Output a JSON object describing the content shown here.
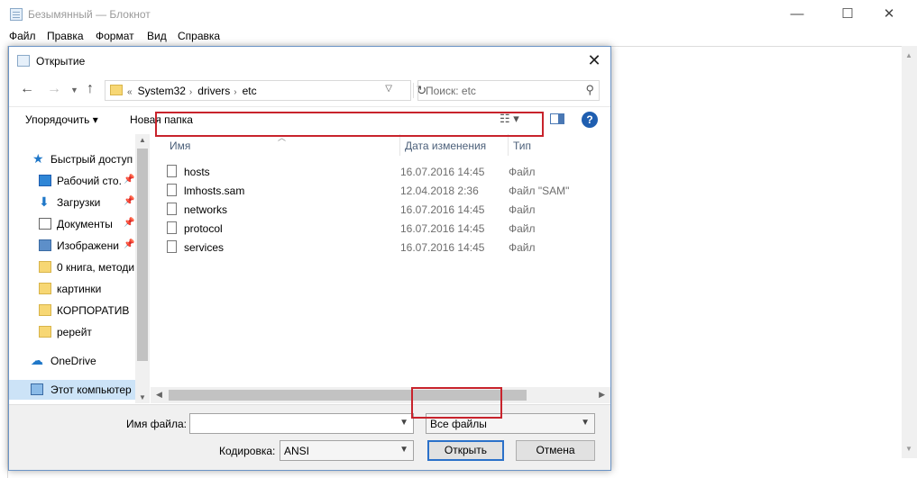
{
  "notepad": {
    "title": "Безымянный — Блокнот",
    "menu": [
      "Файл",
      "Правка",
      "Формат",
      "Вид",
      "Справка"
    ],
    "minimize": "—",
    "maximize": "☐",
    "close": "✕"
  },
  "dialog": {
    "title": "Открытие",
    "close": "✕",
    "address": {
      "prefix": "«",
      "crumbs": [
        "System32",
        "drivers",
        "etc"
      ]
    },
    "search_placeholder": "Поиск: etc",
    "toolbar": {
      "organize": "Упорядочить ▾",
      "new_folder": "Новая папка",
      "help": "?"
    },
    "nav": [
      {
        "label": "Быстрый доступ",
        "icon": "star-icon",
        "pinned": false
      },
      {
        "label": "Рабочий сто.",
        "icon": "desktop-icon",
        "pinned": true
      },
      {
        "label": "Загрузки",
        "icon": "download-icon",
        "pinned": true
      },
      {
        "label": "Документы",
        "icon": "documents-icon",
        "pinned": true
      },
      {
        "label": "Изображени",
        "icon": "pictures-icon",
        "pinned": true
      },
      {
        "label": "0 книга, методи",
        "icon": "folder-icon",
        "pinned": false
      },
      {
        "label": "картинки",
        "icon": "folder-icon",
        "pinned": false
      },
      {
        "label": "КОРПОРАТИВ",
        "icon": "folder-icon",
        "pinned": false
      },
      {
        "label": "ререйт",
        "icon": "folder-icon",
        "pinned": false
      },
      {
        "label": "OneDrive",
        "icon": "cloud-icon",
        "pinned": false
      },
      {
        "label": "Этот компьютер",
        "icon": "computer-icon",
        "pinned": false,
        "selected": true
      }
    ],
    "columns": {
      "name": "Имя",
      "date": "Дата изменения",
      "type": "Тип"
    },
    "files": [
      {
        "name": "hosts",
        "date": "16.07.2016 14:45",
        "type": "Файл"
      },
      {
        "name": "lmhosts.sam",
        "date": "12.04.2018 2:36",
        "type": "Файл \"SAM\""
      },
      {
        "name": "networks",
        "date": "16.07.2016 14:45",
        "type": "Файл"
      },
      {
        "name": "protocol",
        "date": "16.07.2016 14:45",
        "type": "Файл"
      },
      {
        "name": "services",
        "date": "16.07.2016 14:45",
        "type": "Файл"
      }
    ],
    "filename_label": "Имя файла:",
    "filename_value": "",
    "filter_value": "Все файлы",
    "encoding_label": "Кодировка:",
    "encoding_value": "ANSI",
    "open_button": "Открыть",
    "cancel_button": "Отмена"
  },
  "colors": {
    "highlight": "#c8232c",
    "accent": "#2b71c9",
    "selection": "#cce3f7"
  }
}
